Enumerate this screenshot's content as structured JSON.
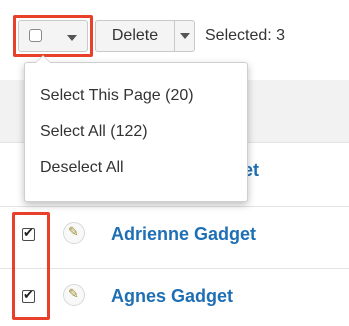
{
  "toolbar": {
    "select_icon": "checkbox-icon",
    "dropdown_icon": "chevron-down-icon",
    "delete_label": "Delete",
    "selected_label": "Selected: 3"
  },
  "menu": {
    "items": [
      {
        "label": "Select This Page (20)"
      },
      {
        "label": "Select All (122)"
      },
      {
        "label": "Deselect All"
      }
    ]
  },
  "rows": [
    {
      "name": "Gadget",
      "checked": true
    },
    {
      "name": "Adrienne Gadget",
      "checked": true
    },
    {
      "name": "Agnes Gadget",
      "checked": true
    }
  ],
  "icons": {
    "edit": "pencil-icon",
    "check": "checkmark-icon"
  },
  "colors": {
    "highlight": "#e8402b",
    "link": "#1f6fb5"
  }
}
